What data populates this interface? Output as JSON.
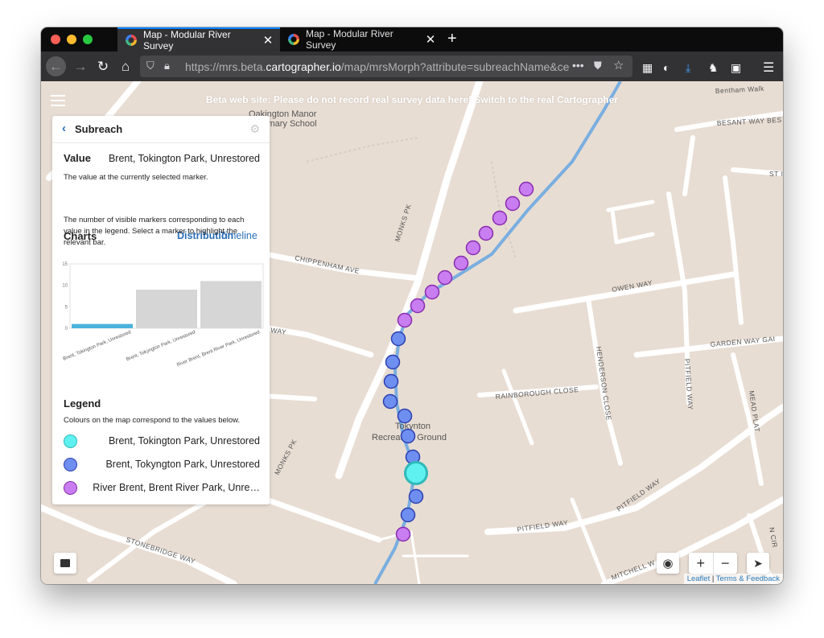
{
  "browser": {
    "tabs": [
      {
        "title": "Map - Modular River Survey",
        "active": true
      },
      {
        "title": "Map - Modular River Survey",
        "active": false
      }
    ],
    "url_host": "https://mrs.beta.",
    "url_domain": "cartographer.io",
    "url_path": "/map/mrsMorph?attribute=subreachName&ce"
  },
  "banner": {
    "text": "Beta web site: Please do not record real survey data here!",
    "link": "Switch to the real Cartographer"
  },
  "panel": {
    "title": "Subreach",
    "value_label": "Value",
    "value": "Brent, Tokington Park, Unrestored",
    "value_help": "The value at the currently selected marker.",
    "charts_label": "Charts",
    "tabs": [
      "Distribution",
      "Timeline"
    ],
    "charts_help": "The number of visible markers corresponding to each value in the legend. Select a marker to highlight the relevant bar.",
    "legend_title": "Legend",
    "legend_help": "Colours on the map correspond to the values below.",
    "legend": [
      {
        "label": "Brent, Tokington Park, Unrestored",
        "color": "#5ff0f0",
        "stroke": "#2fb9b9"
      },
      {
        "label": "Brent, Tokyngton Park, Unrestored",
        "color": "#6f8ff0",
        "stroke": "#2c3fb0"
      },
      {
        "label": "River Brent, Brent River Park, Unre…",
        "color": "#c87ef0",
        "stroke": "#8a2cb0"
      }
    ]
  },
  "chart_data": {
    "type": "bar",
    "categories": [
      "Brent, Tokington Park, Unrestored",
      "Brent, Tokyngton Park, Unrestored",
      "River Brent, Brent River Park, Unrestored"
    ],
    "values": [
      1,
      9,
      11
    ],
    "ylim": [
      0,
      15
    ],
    "yticks": [
      "0",
      "5",
      "10",
      "15"
    ],
    "highlight_index": 0,
    "colors": {
      "highlight": "#4ab3dd",
      "normal": "#d6d6d6"
    }
  },
  "map": {
    "places": [
      "Oakington Manor",
      "Primary School",
      "Tokynton",
      "Recreation Ground"
    ],
    "streets": [
      "MONKS PK",
      "CHIPPENHAM AVE",
      "OWEN WAY",
      "GARDEN WAY",
      "HENDERSON CLOSE",
      "RAINBOROUGH CLOSE",
      "PITFIELD WAY",
      "MEAD PLAT",
      "MONKS PK",
      "STONEBRIDGE WAY",
      "PITFIELD WAY",
      "MITCHELL W",
      "BESANT WAY",
      "Bentham Walk",
      "WEMBLEY WAY",
      "WAY"
    ]
  },
  "controls": {
    "zoom_in": "+",
    "zoom_out": "−"
  },
  "attribution": {
    "leaflet": "Leaflet",
    "sep": " | ",
    "terms": "Terms & Feedback"
  }
}
